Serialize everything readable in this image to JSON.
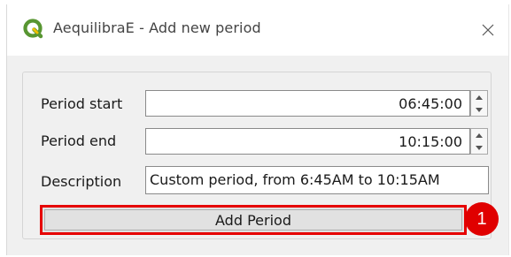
{
  "window": {
    "title": "AequilibraE - Add new period"
  },
  "form": {
    "period_start": {
      "label": "Period start",
      "value": "06:45:00"
    },
    "period_end": {
      "label": "Period end",
      "value": "10:15:00"
    },
    "description": {
      "label": "Description",
      "value": "Custom period, from 6:45AM to 10:15AM"
    }
  },
  "actions": {
    "add_period_label": "Add Period"
  },
  "annotation": {
    "step_number": "1"
  },
  "colors": {
    "highlight_border": "#e60000",
    "badge": "#e00000",
    "qgis_green": "#589632",
    "qgis_yellow": "#f0c000"
  }
}
